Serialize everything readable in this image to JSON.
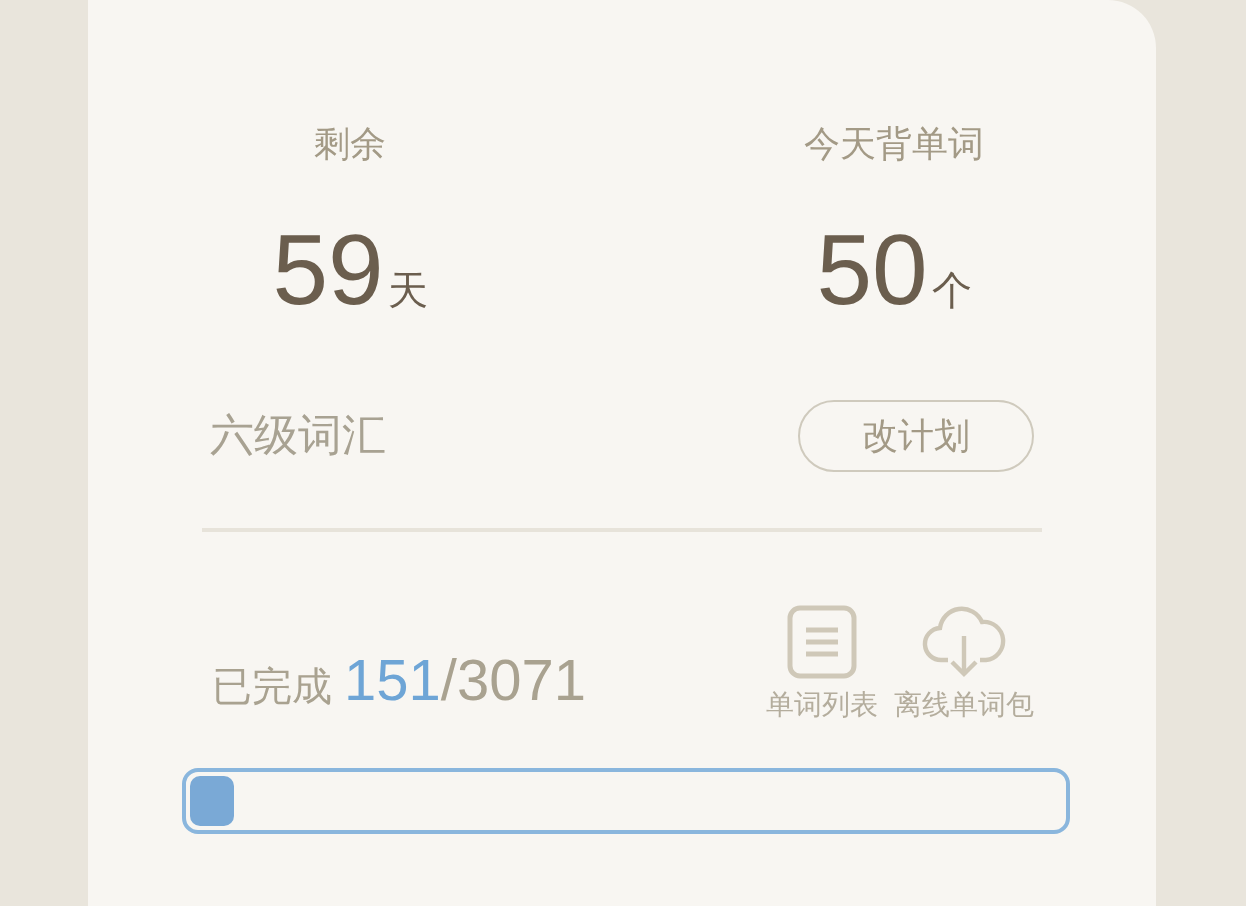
{
  "stats": [
    {
      "label": "剩余",
      "value": "59",
      "unit": "天"
    },
    {
      "label": "今天背单词",
      "value": "50",
      "unit": "个"
    }
  ],
  "plan": {
    "name": "六级词汇",
    "button": "改计划"
  },
  "progress": {
    "label": "已完成",
    "done": "151",
    "total": "/3071",
    "level": 0.05
  },
  "actions": [
    {
      "kind": "list",
      "label": "单词列表"
    },
    {
      "kind": "download",
      "label": "离线单词包"
    }
  ]
}
